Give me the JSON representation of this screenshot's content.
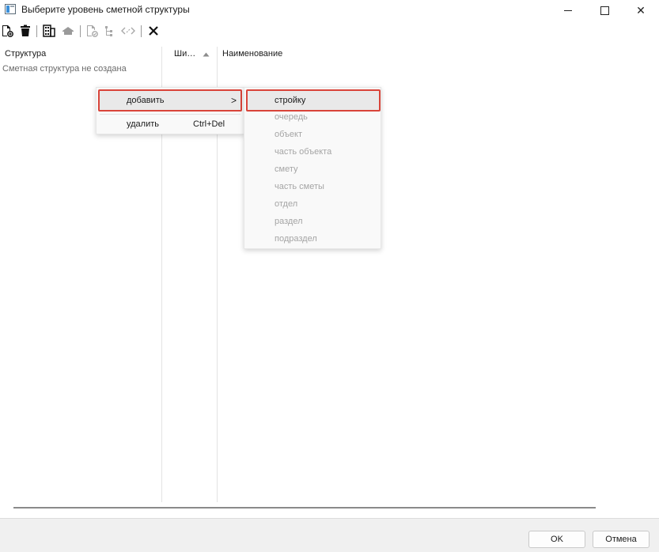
{
  "window": {
    "title": "Выберите уровень сметной структуры",
    "minimize_icon": "minimize-icon",
    "maximize_icon": "maximize-icon",
    "close_glyph": "✕"
  },
  "toolbar": {
    "icons": [
      "add-document-icon",
      "delete-icon",
      "building-icon",
      "house-icon",
      "document-check-icon",
      "tree-icon",
      "code-icon",
      "close-icon"
    ]
  },
  "columns": {
    "structure": "Структура",
    "short": "Ши…",
    "name": "Наименование"
  },
  "tree": {
    "empty_message": "Сметная структура не создана"
  },
  "context_menu": {
    "add_label": "добавить",
    "add_arrow": ">",
    "delete_label": "удалить",
    "delete_shortcut": "Ctrl+Del"
  },
  "submenu": {
    "items": [
      "стройку",
      "очередь",
      "объект",
      "часть объекта",
      "смету",
      "часть сметы",
      "отдел",
      "раздел",
      "подраздел"
    ]
  },
  "footer": {
    "ok_label": "OK",
    "cancel_label": "Отмена"
  },
  "colors": {
    "highlight_border": "#d9443a",
    "disabled_text": "#a5a5a5"
  }
}
